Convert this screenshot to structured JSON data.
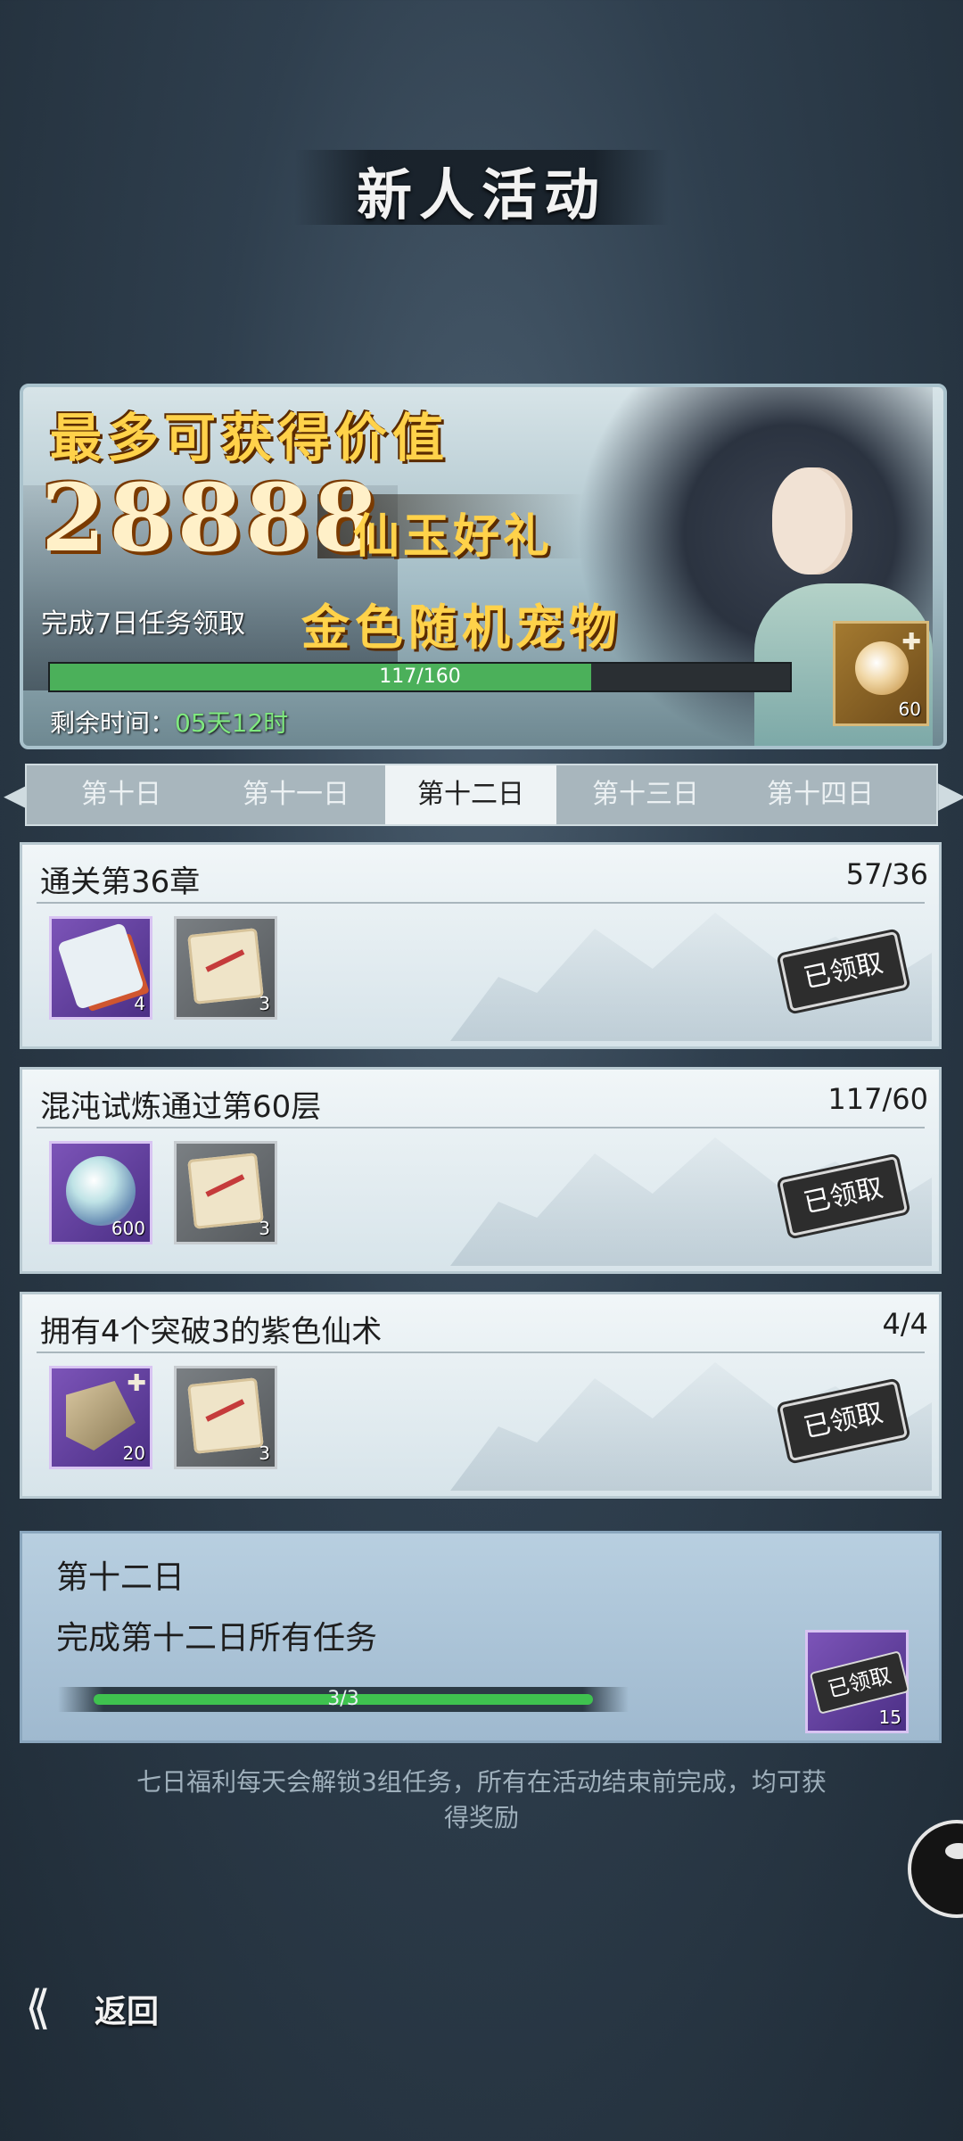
{
  "page": {
    "title": "新人活动"
  },
  "banner": {
    "headline": "最多可获得价值",
    "amount": "28888",
    "amount_suffix": "仙玉好礼",
    "task_note": "完成7日任务领取",
    "pet_reward": "金色随机宠物",
    "progress": {
      "text": "117/160",
      "current": 117,
      "total": 160
    },
    "time_label": "剩余时间：",
    "time_value": "05天12时",
    "reward_item": {
      "icon": "pet-egg-icon",
      "count": "60"
    }
  },
  "tabs": [
    {
      "label": "第十日"
    },
    {
      "label": "第十一日"
    },
    {
      "label": "第十二日",
      "active": true
    },
    {
      "label": "第十三日"
    },
    {
      "label": "第十四日"
    }
  ],
  "tasks": [
    {
      "title": "通关第36章",
      "progress": "57/36",
      "rewards": [
        {
          "icon": "talisman-icon",
          "count": "4"
        },
        {
          "icon": "scroll-icon",
          "count": "3"
        }
      ],
      "status": "已领取"
    },
    {
      "title": "混沌试炼通过第60层",
      "progress": "117/60",
      "rewards": [
        {
          "icon": "spirit-orb-icon",
          "count": "600"
        },
        {
          "icon": "scroll-icon",
          "count": "3"
        }
      ],
      "status": "已领取"
    },
    {
      "title": "拥有4个突破3的紫色仙术",
      "progress": "4/4",
      "rewards": [
        {
          "icon": "map-fragment-icon",
          "count": "20"
        },
        {
          "icon": "scroll-icon",
          "count": "3"
        }
      ],
      "status": "已领取"
    }
  ],
  "summary": {
    "day": "第十二日",
    "desc": "完成第十二日所有任务",
    "progress_text": "3/3",
    "progress_fraction": 1.0,
    "reward": {
      "icon": "chest-icon",
      "count": "15",
      "status": "已领取"
    }
  },
  "footer_note": "七日福利每天会解锁3组任务，所有在活动结束前完成，均可获得奖励",
  "back": {
    "label": "返回"
  }
}
